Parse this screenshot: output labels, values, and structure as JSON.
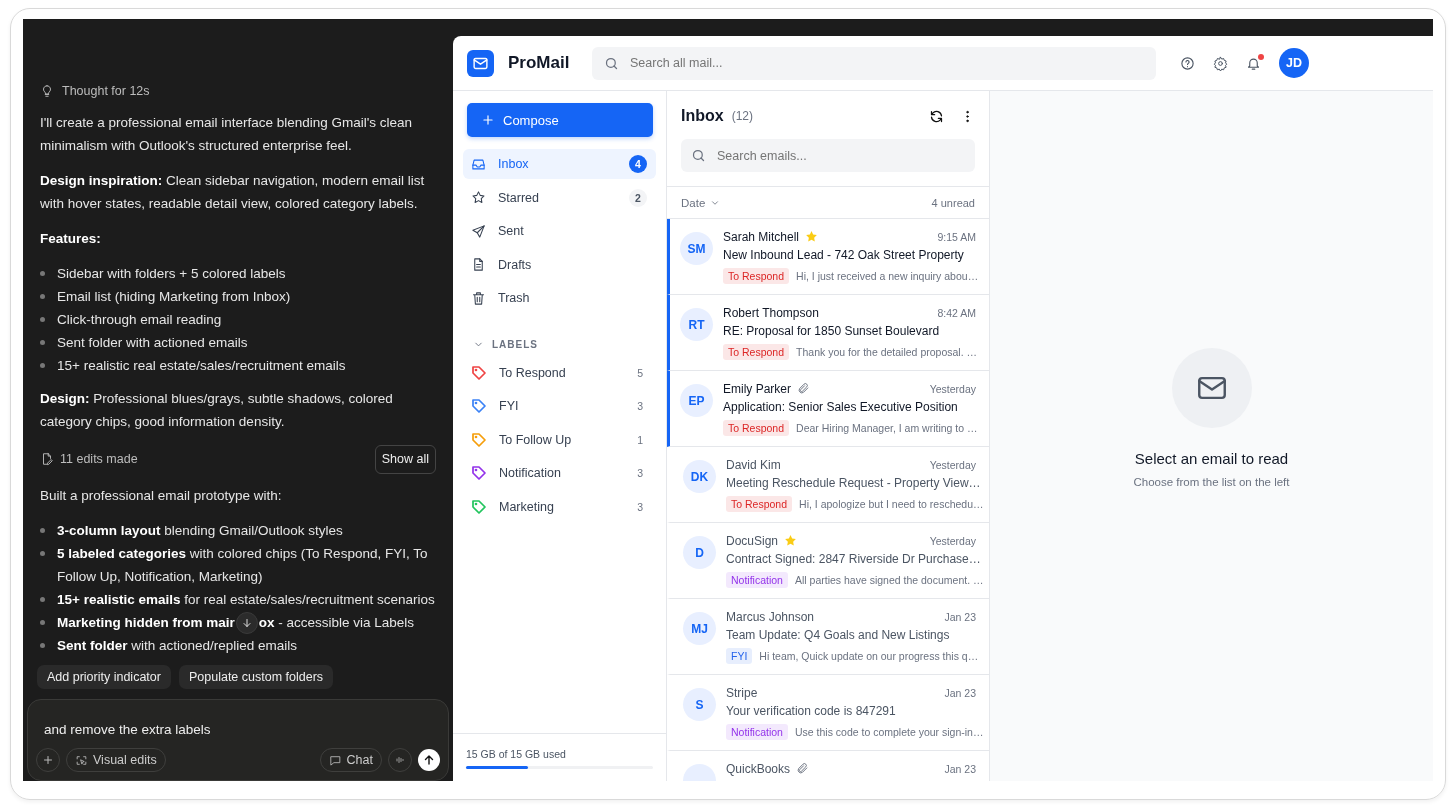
{
  "chat": {
    "thought": "Thought for 12s",
    "blocks": [
      {
        "kind": "paragraph",
        "text": "I'll create a professional email interface blending Gmail's clean minimalism with Outlook's structured enterprise feel."
      },
      {
        "kind": "paragraph",
        "text": "**Design inspiration:** Clean sidebar navigation, modern email list with hover states, readable detail view, colored category labels."
      },
      {
        "kind": "heading",
        "text": "Features:"
      },
      {
        "kind": "bullets",
        "items": [
          "Sidebar with folders + 5 colored labels",
          "Email list (hiding Marketing from Inbox)",
          "Click-through email reading",
          "Sent folder with actioned emails",
          "15+ realistic real estate/sales/recruitment emails"
        ]
      },
      {
        "kind": "paragraph",
        "text": "**Design:** Professional blues/grays, subtle shadows, colored category chips, good information density."
      },
      {
        "kind": "edits",
        "text": "11 edits made",
        "button": "Show all"
      },
      {
        "kind": "paragraph",
        "text": "Built a professional email prototype with:"
      },
      {
        "kind": "bullets",
        "items": [
          "**3-column layout** blending Gmail/Outlook styles",
          "**5 labeled categories** with colored chips (To Respond, FYI, To Follow Up, Notification, Marketing)",
          "**15+ realistic emails** for real estate/sales/recruitment scenarios",
          {
            "text": "**Marketing hidden from mair**",
            "after": "**ox** - accessible via Labels"
          },
          "**Sent folder** with actioned/replied emails"
        ]
      }
    ],
    "suggestions": [
      "Add priority indicator",
      "Populate custom folders"
    ],
    "input": {
      "value": "and remove the extra labels"
    },
    "buttons": {
      "visual_edits": "Visual edits",
      "chat": "Chat"
    }
  },
  "app": {
    "brand": "ProMail",
    "search": {
      "placeholder": "Search all mail..."
    },
    "avatar": "JD",
    "notification_dot": true,
    "compose": "Compose",
    "folders": [
      {
        "label": "Inbox",
        "count": "4",
        "selected": true
      },
      {
        "label": "Starred",
        "count": "2",
        "selected": false
      },
      {
        "label": "Sent",
        "selected": false
      },
      {
        "label": "Drafts",
        "selected": false
      },
      {
        "label": "Trash",
        "selected": false
      }
    ],
    "labels_heading": "LABELS",
    "labels_expanded": true,
    "labels": [
      {
        "label": "To Respond",
        "count": "5",
        "color": "#ef4444"
      },
      {
        "label": "FYI",
        "count": "3",
        "color": "#3b82f6"
      },
      {
        "label": "To Follow Up",
        "count": "1",
        "color": "#f59e0b"
      },
      {
        "label": "Notification",
        "count": "3",
        "color": "#9333ea"
      },
      {
        "label": "Marketing",
        "count": "3",
        "color": "#22c55e"
      }
    ],
    "storage": {
      "text": "15 GB of 15 GB used",
      "level": 0.33
    },
    "list": {
      "title": "Inbox",
      "count": "(12)",
      "search": {
        "placeholder": "Search emails..."
      },
      "sort": "Date",
      "unread": "4 unread",
      "emails": [
        {
          "initials": "SM",
          "sender": "Sarah Mitchell",
          "starred": true,
          "attachment": false,
          "time": "9:15 AM",
          "subject": "New Inbound Lead - 742 Oak Street Property",
          "tag": {
            "text": "To Respond",
            "color": "#dc2626"
          },
          "preview": "Hi, I just received a new inquiry abou…",
          "unread": true
        },
        {
          "initials": "RT",
          "sender": "Robert Thompson",
          "starred": false,
          "attachment": false,
          "time": "8:42 AM",
          "subject": "RE: Proposal for 1850 Sunset Boulevard",
          "tag": {
            "text": "To Respond",
            "color": "#dc2626"
          },
          "preview": "Thank you for the detailed proposal. …",
          "unread": true
        },
        {
          "initials": "EP",
          "sender": "Emily Parker",
          "starred": false,
          "attachment": true,
          "time": "Yesterday",
          "subject": "Application: Senior Sales Executive Position",
          "tag": {
            "text": "To Respond",
            "color": "#dc2626"
          },
          "preview": "Dear Hiring Manager, I am writing to …",
          "unread": true
        },
        {
          "initials": "DK",
          "sender": "David Kim",
          "starred": false,
          "attachment": false,
          "time": "Yesterday",
          "subject": "Meeting Reschedule Request - Property View…",
          "tag": {
            "text": "To Respond",
            "color": "#dc2626"
          },
          "preview": "Hi, I apologize but I need to reschedu…",
          "unread": false
        },
        {
          "initials": "D",
          "sender": "DocuSign",
          "starred": true,
          "attachment": false,
          "time": "Yesterday",
          "subject": "Contract Signed: 2847 Riverside Dr Purchase…",
          "tag": {
            "text": "Notification",
            "color": "#9333ea"
          },
          "preview": "All parties have signed the document. …",
          "unread": false
        },
        {
          "initials": "MJ",
          "sender": "Marcus Johnson",
          "starred": false,
          "attachment": false,
          "time": "Jan 23",
          "subject": "Team Update: Q4 Goals and New Listings",
          "tag": {
            "text": "FYI",
            "color": "#2563eb"
          },
          "preview": "Hi team, Quick update on our progress this q…",
          "unread": false
        },
        {
          "initials": "S",
          "sender": "Stripe",
          "starred": false,
          "attachment": false,
          "time": "Jan 23",
          "subject": "Your verification code is 847291",
          "tag": {
            "text": "Notification",
            "color": "#9333ea"
          },
          "preview": "Use this code to complete your sign-in…",
          "unread": false
        },
        {
          "sender": "QuickBooks",
          "starred": false,
          "attachment": true,
          "time": "Jan 23",
          "unread": false
        }
      ]
    },
    "detail": {
      "title": "Select an email to read",
      "subtitle": "Choose from the list on the left"
    }
  }
}
